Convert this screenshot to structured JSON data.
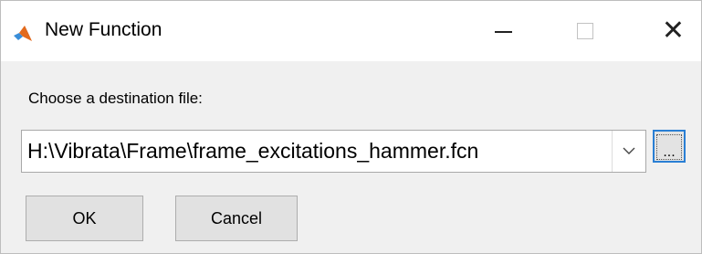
{
  "window": {
    "title": "New Function",
    "app_icon": "matlab-logo-icon",
    "controls": {
      "minimize": "minimize-icon",
      "maximize": "maximize-icon",
      "close": "close-icon",
      "close_glyph": "✕"
    }
  },
  "dialog": {
    "prompt": "Choose a destination file:",
    "destination": {
      "value": "H:\\Vibrata\\Frame\\frame_excitations_hammer.fcn",
      "dropdown_icon": "chevron-down-icon"
    },
    "browse_label": "...",
    "buttons": {
      "ok": "OK",
      "cancel": "Cancel"
    }
  },
  "colors": {
    "accent": "#2a7fd4",
    "dialog_bg": "#f0f0f0",
    "button_bg": "#e1e1e1"
  }
}
